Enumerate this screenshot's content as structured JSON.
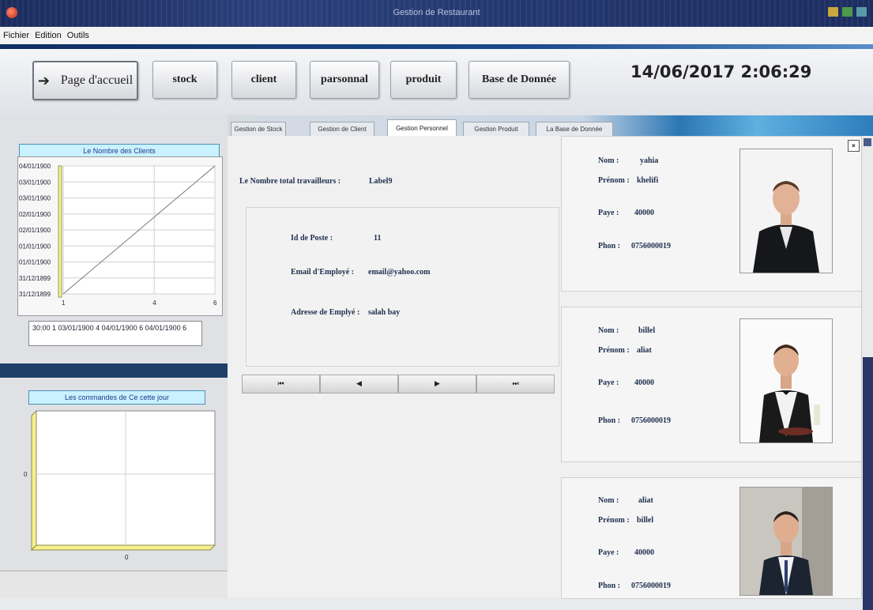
{
  "window": {
    "title": "Gestion de Restaurant"
  },
  "menu": [
    "Fichier",
    "Edition",
    "Outils"
  ],
  "toolbar": {
    "home": "Page d'accueil",
    "stock": "stock",
    "client": "client",
    "personnel": "parsonnal",
    "produit": "produit",
    "base": "Base de Donnée"
  },
  "datetime": "14/06/2017 2:06:29",
  "tabs": [
    "Gestion de Stock",
    "Gestion de Client",
    "Gestion Personnel",
    "Gestion Produit",
    "La Base de Donnée"
  ],
  "personnel": {
    "total_label": "Le Nombre total travailleurs :",
    "total_value": "Label9",
    "id_label": "Id de Poste :",
    "id_value": "11",
    "email_label": "Email d'Employé :",
    "email_value": "email@yahoo.com",
    "address_label": "Adresse de Emplyé :",
    "address_value": "salah bay"
  },
  "nav": [
    "⏮",
    "◀",
    "▶",
    "⏭"
  ],
  "employee_labels": {
    "nom": "Nom :",
    "prenom": "Prénom :",
    "paye": "Paye :",
    "phone": "Phon :"
  },
  "employees": [
    {
      "nom": "yahia",
      "prenom": "khelifi",
      "paye": "40000",
      "phone": "0756000019"
    },
    {
      "nom": "billel",
      "prenom": "aliat",
      "paye": "40000",
      "phone": "0756000019"
    },
    {
      "nom": "aliat",
      "prenom": "billel",
      "paye": "40000",
      "phone": "0756000019"
    }
  ],
  "chart_data": [
    {
      "type": "line",
      "title": "Le Nombre des Clients",
      "x_ticks": [
        "1",
        "4",
        "6"
      ],
      "y_ticks": [
        "04/01/1900",
        "03/01/1900",
        "03/01/1900",
        "02/01/1900",
        "02/01/1900",
        "01/01/1900",
        "01/01/1900",
        "31/12/1899",
        "31/12/1899"
      ],
      "series": [
        {
          "x": [
            1,
            6
          ],
          "y": [
            "31/12/1899",
            "04/01/1900"
          ]
        }
      ],
      "legend": "30:00 1   03/01/1900 4   04/01/1900 6   04/01/1900 6",
      "grid": true
    },
    {
      "type": "bar",
      "title": "Les commandes de Ce cette jour",
      "x_ticks": [
        "0"
      ],
      "y_ticks": [
        "0"
      ],
      "values": [
        0
      ],
      "grid": true
    }
  ],
  "colors": {
    "title_bar": "#1f3068",
    "chart_title_bg": "#c9f1ff",
    "chart_accent": "#f5f08a"
  }
}
